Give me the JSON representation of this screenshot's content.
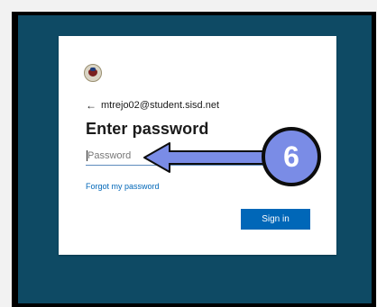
{
  "login": {
    "account": "mtrejo02@student.sisd.net",
    "back_arrow": "←",
    "heading": "Enter password",
    "password_placeholder": "Password",
    "forgot_link": "Forgot my password",
    "signin_label": "Sign in"
  },
  "annotation": {
    "step_number": "6"
  },
  "icons": {
    "logo": "school-seal-icon",
    "back": "back-arrow-icon",
    "pointer": "annotation-arrow-icon"
  },
  "colors": {
    "background": "#0e4a64",
    "card": "#ffffff",
    "accent": "#0067b8",
    "annotation": "#7a8ce6"
  }
}
